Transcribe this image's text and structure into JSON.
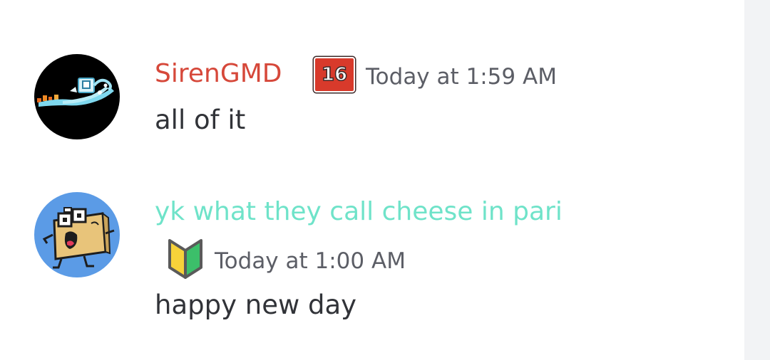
{
  "messages": [
    {
      "author": "SirenGMD",
      "author_color": "#d6483a",
      "badge": "16",
      "badge_color": "#d83a2b",
      "timestamp": "Today at 1:59 AM",
      "content": "all of it",
      "avatar_icon": "siren-avatar"
    },
    {
      "author": "yk what they call cheese in pari",
      "author_color": "#6fe3c9",
      "badge_icon": "beginner-mark-icon",
      "timestamp": "Today at 1:00 AM",
      "content": "happy new day",
      "avatar_icon": "cheese-character-avatar"
    }
  ],
  "colors": {
    "background": "#ffffff",
    "scrollbar_track": "#f2f3f5",
    "timestamp": "#5c5e66",
    "message_text": "#313338"
  }
}
